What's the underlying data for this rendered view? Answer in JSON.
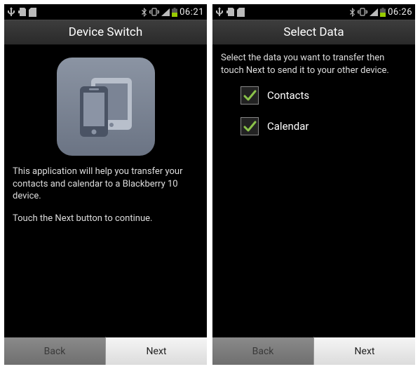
{
  "screens": [
    {
      "status": {
        "time": "06:21"
      },
      "title": "Device Switch",
      "body": {
        "line1": "This application will help you transfer your contacts and calendar to a Blackberry 10 device.",
        "line2": "Touch the Next button to continue."
      },
      "buttons": {
        "back": "Back",
        "next": "Next"
      }
    },
    {
      "status": {
        "time": "06:26"
      },
      "title": "Select Data",
      "body": {
        "intro": "Select the data you want to transfer then touch Next to send it to your other device."
      },
      "options": [
        {
          "label": "Contacts",
          "checked": true
        },
        {
          "label": "Calendar",
          "checked": true
        }
      ],
      "buttons": {
        "back": "Back",
        "next": "Next"
      }
    }
  ]
}
